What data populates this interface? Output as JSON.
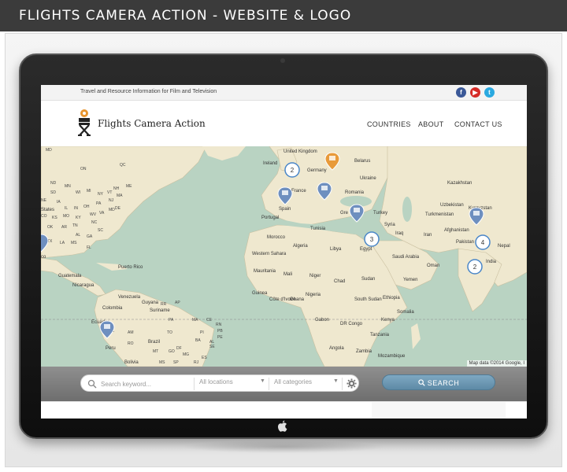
{
  "banner": {
    "title": "FLIGHTS CAMERA ACTION - WEBSITE & LOGO"
  },
  "site": {
    "tagline": "Travel and Resource Information for Film and Television",
    "brand": "Flights Camera Action",
    "social": {
      "facebook": "f",
      "youtube": "▶",
      "twitter": "t"
    },
    "nav": [
      "COUNTRIES",
      "ABOUT",
      "CONTACT US"
    ]
  },
  "map": {
    "credit": "Map data ©2014 Google, I",
    "clusters": [
      "2",
      "3",
      "4",
      "2"
    ],
    "labels": {
      "united_kingdom": "United Kingdom",
      "ireland": "Ireland",
      "germany": "Germany",
      "belarus": "Belarus",
      "ukraine": "Ukraine",
      "france": "France",
      "romania": "Romania",
      "spain": "Spain",
      "portugal": "Portugal",
      "greece": "Gre",
      "turkey": "Turkey",
      "kazakhstan": "Kazakhstan",
      "uzbekistan": "Uzbekistan",
      "kyrgyzstan": "Kyrgyzstan",
      "turkmenistan": "Turkmenistan",
      "afghanistan": "Afghanistan",
      "pakistan": "Pakistan",
      "nepal": "Nepal",
      "india": "India",
      "iran": "Iran",
      "iraq": "Iraq",
      "syria": "Syria",
      "tunisia": "Tunisia",
      "morocco": "Morocco",
      "algeria": "Algeria",
      "libya": "Libya",
      "egypt": "Egypt",
      "saudi": "Saudi Arabia",
      "oman": "Oman",
      "yemen": "Yemen",
      "western_sahara": "Western Sahara",
      "mauritania": "Mauritania",
      "mali": "Mali",
      "niger": "Niger",
      "chad": "Chad",
      "sudan": "Sudan",
      "south_sudan": "South Sudan",
      "ethiopia": "Ethiopia",
      "somalia": "Somalia",
      "nigeria": "Nigeria",
      "kenya": "Kenya",
      "gabon": "Gabon",
      "drc": "DR Congo",
      "tanzania": "Tanzania",
      "angola": "Angola",
      "zambia": "Zambia",
      "mozambique": "Mozambique",
      "guinea": "Guinea",
      "cote": "Côte d'Ivoire",
      "ghana": "Ghana",
      "states": "States",
      "mexico": "co",
      "puerto_rico": "Puerto Rico",
      "guatemala": "Guatemala",
      "nicaragua": "Nicaragua",
      "venezuela": "Venezuela",
      "colombia": "Colombia",
      "guyana": "Guyana",
      "suriname": "Suriname",
      "peru": "Peru",
      "brazil": "Brazil",
      "bolivia": "Bolivia",
      "ecuador": "Ecuador",
      "us_states": [
        "MD",
        "ON",
        "QC",
        "ND",
        "MN",
        "SD",
        "WI",
        "MI",
        "NY",
        "NE",
        "IA",
        "IL",
        "IN",
        "OH",
        "PA",
        "NJ",
        "MA",
        "VT",
        "NH",
        "ME",
        "CO",
        "KS",
        "MO",
        "KY",
        "WV",
        "VA",
        "MD",
        "DE",
        "OK",
        "AR",
        "TN",
        "NC",
        "SC",
        "AL",
        "GA",
        "TX",
        "LA",
        "MS",
        "FL"
      ],
      "br_states": [
        "AP",
        "RR",
        "AM",
        "PA",
        "MA",
        "CE",
        "RN",
        "PB",
        "PE",
        "AC",
        "RO",
        "TO",
        "BA",
        "SE",
        "MT",
        "GO",
        "DF",
        "MG",
        "ES",
        "RJ",
        "SP",
        "MS",
        "AL",
        "PI"
      ]
    }
  },
  "search": {
    "keyword_placeholder": "Search keyword...",
    "locations": "All locations",
    "categories": "All categories",
    "button": "SEARCH"
  }
}
